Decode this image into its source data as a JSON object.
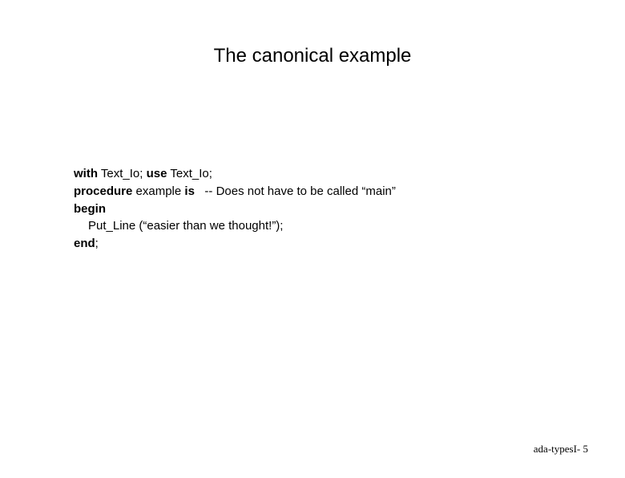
{
  "title": "The canonical example",
  "code": {
    "l1": {
      "kw1": "with",
      "t1": " Text_Io; ",
      "kw2": "use",
      "t2": " Text_Io;"
    },
    "l2": {
      "kw1": "procedure",
      "t1": " example ",
      "kw2": "is",
      "t2": "   -- Does not have to be called “main”"
    },
    "l3": {
      "kw1": "begin"
    },
    "l4": {
      "t1": "Put_Line (“easier than we thought!”);"
    },
    "l5": {
      "kw1": "end",
      "t1": ";"
    }
  },
  "footer": "ada-typesI- 5"
}
